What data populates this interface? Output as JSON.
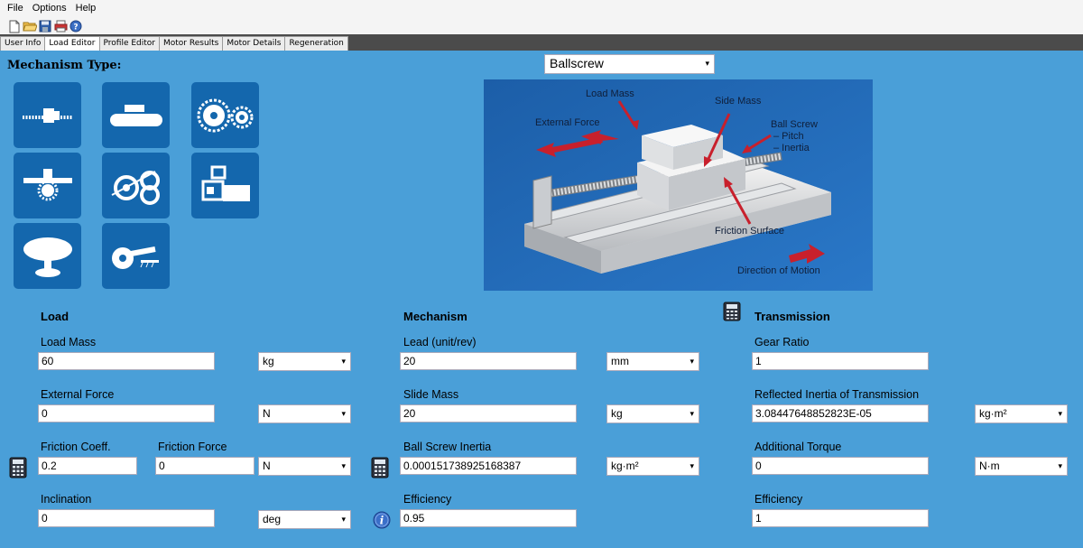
{
  "menu": {
    "items": [
      "File",
      "Options",
      "Help"
    ]
  },
  "toolbar": {
    "icons": [
      "new-icon",
      "open-icon",
      "save-icon",
      "print-icon",
      "help-icon"
    ]
  },
  "tabs": [
    "User Info",
    "Load Editor",
    "Profile Editor",
    "Motor Results",
    "Motor Details",
    "Regeneration"
  ],
  "active_tab": "Load Editor",
  "mechanism_type": {
    "label": "Mechanism Type:",
    "selected": "Ballscrew"
  },
  "mechanism_tiles": [
    "ballscrew-icon",
    "conveyor-icon",
    "chain-sprocket-icon",
    "rack-pinion-icon",
    "winding-roll-icon",
    "gearbox-icon",
    "rotary-table-icon",
    "cam-crank-icon"
  ],
  "diagram": {
    "labels": {
      "load_mass": "Load Mass",
      "external_force": "External Force",
      "side_mass": "Side Mass",
      "ball_screw": "Ball Screw",
      "pitch": "– Pitch",
      "inertia": "– Inertia",
      "friction_surface": "Friction Surface",
      "direction": "Direction of Motion"
    }
  },
  "load": {
    "heading": "Load",
    "load_mass": {
      "label": "Load Mass",
      "value": "60",
      "unit": "kg"
    },
    "external_force": {
      "label": "External Force",
      "value": "0",
      "unit": "N"
    },
    "friction_coeff": {
      "label": "Friction Coeff.",
      "value": "0.2"
    },
    "friction_force": {
      "label": "Friction Force",
      "value": "0",
      "unit": "N"
    },
    "inclination": {
      "label": "Inclination",
      "value": "0",
      "unit": "deg"
    }
  },
  "mechanism": {
    "heading": "Mechanism",
    "lead": {
      "label": "Lead (unit/rev)",
      "value": "20",
      "unit": "mm"
    },
    "slide_mass": {
      "label": "Slide Mass",
      "value": "20",
      "unit": "kg"
    },
    "ball_screw_inertia": {
      "label": "Ball Screw Inertia",
      "value": "0.000151738925168387",
      "unit": "kg·m²"
    },
    "efficiency": {
      "label": "Efficiency",
      "value": "0.95"
    }
  },
  "transmission": {
    "heading": "Transmission",
    "gear_ratio": {
      "label": "Gear Ratio",
      "value": "1"
    },
    "reflected_inertia": {
      "label": "Reflected Inertia of Transmission",
      "value": "3.08447648852823E-05",
      "unit": "kg·m²"
    },
    "additional_torque": {
      "label": "Additional Torque",
      "value": "0",
      "unit": "N·m"
    },
    "efficiency": {
      "label": "Efficiency",
      "value": "1"
    }
  },
  "colors": {
    "background": "#4a9fd8",
    "tile": "#1467ad",
    "diagram_bg": "#1d64b0",
    "arrow_red": "#c8202c"
  }
}
